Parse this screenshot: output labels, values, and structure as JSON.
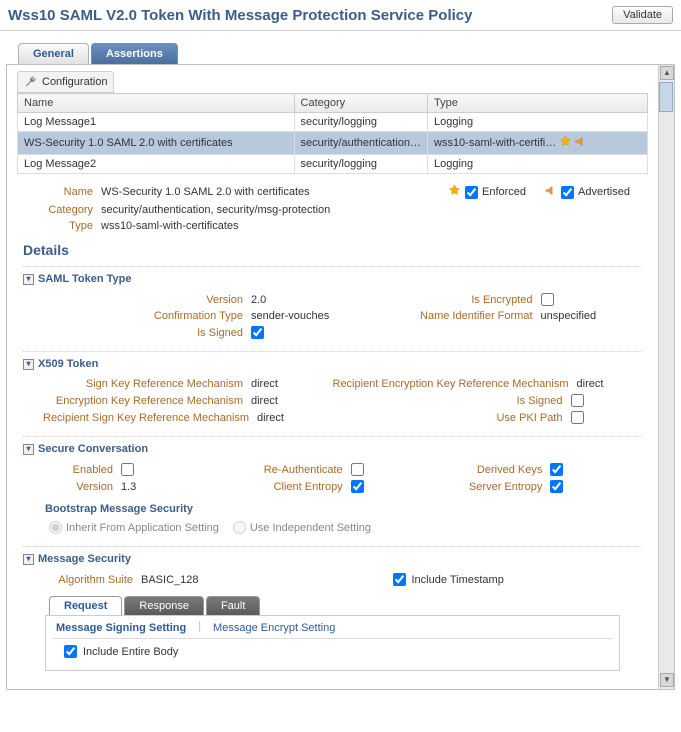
{
  "header": {
    "title": "Wss10 SAML V2.0 Token With Message Protection Service Policy",
    "validate": "Validate"
  },
  "tabs": {
    "general": "General",
    "assertions": "Assertions"
  },
  "configLabel": "Configuration",
  "tableHeaders": {
    "name": "Name",
    "category": "Category",
    "type": "Type"
  },
  "tableRows": [
    {
      "name": "Log Message1",
      "category": "security/logging",
      "type": "Logging"
    },
    {
      "name": "WS-Security 1.0 SAML 2.0 with certificates",
      "category": "security/authentication…",
      "type": "wss10-saml-with-certifi…"
    },
    {
      "name": "Log Message2",
      "category": "security/logging",
      "type": "Logging"
    }
  ],
  "props": {
    "nameLbl": "Name",
    "nameVal": "WS-Security 1.0 SAML 2.0 with certificates",
    "catLbl": "Category",
    "catVal": "security/authentication, security/msg-protection",
    "typeLbl": "Type",
    "typeVal": "wss10-saml-with-certificates",
    "enforcedLbl": "Enforced",
    "advertisedLbl": "Advertised"
  },
  "detailsTitle": "Details",
  "saml": {
    "title": "SAML Token Type",
    "versionLbl": "Version",
    "versionVal": "2.0",
    "confLbl": "Confirmation Type",
    "confVal": "sender-vouches",
    "signedLbl": "Is Signed",
    "encLbl": "Is Encrypted",
    "nifLbl": "Name Identifier Format",
    "nifVal": "unspecified"
  },
  "x509": {
    "title": "X509 Token",
    "signKeyLbl": "Sign Key Reference Mechanism",
    "signKeyVal": "direct",
    "encKeyLbl": "Encryption Key Reference Mechanism",
    "encKeyVal": "direct",
    "recSignLbl": "Recipient Sign Key Reference Mechanism",
    "recSignVal": "direct",
    "recEncLbl": "Recipient Encryption Key Reference Mechanism",
    "recEncVal": "direct",
    "isSignedLbl": "Is Signed",
    "pkiLbl": "Use PKI Path"
  },
  "secure": {
    "title": "Secure Conversation",
    "enabledLbl": "Enabled",
    "versionLbl": "Version",
    "versionVal": "1.3",
    "reauthLbl": "Re-Authenticate",
    "clientEntLbl": "Client Entropy",
    "derivedLbl": "Derived Keys",
    "serverEntLbl": "Server Entropy",
    "bootstrapTitle": "Bootstrap Message Security",
    "inheritLbl": "Inherit From Application Setting",
    "independentLbl": "Use Independent Setting"
  },
  "msgsec": {
    "title": "Message Security",
    "algoLbl": "Algorithm Suite",
    "algoVal": "BASIC_128",
    "tsLbl": "Include Timestamp",
    "tabReq": "Request",
    "tabResp": "Response",
    "tabFault": "Fault",
    "signingTab": "Message Signing Setting",
    "encryptTab": "Message Encrypt Setting",
    "entireBodyLbl": "Include Entire Body"
  }
}
